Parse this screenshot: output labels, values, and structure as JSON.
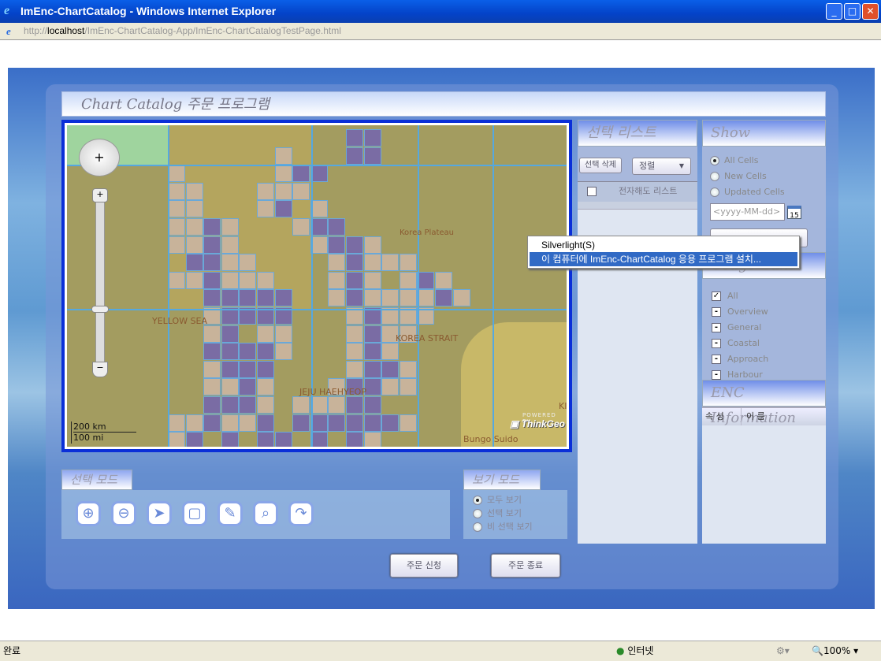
{
  "window": {
    "title": "ImEnc-ChartCatalog - Windows Internet Explorer",
    "url_prefix": "http://",
    "url_host": "localhost",
    "url_path": "/ImEnc-ChartCatalog-App/ImEnc-ChartCatalogTestPage.html"
  },
  "app": {
    "title": "Chart Catalog 주문 프로그램"
  },
  "map": {
    "labels": {
      "yellow_sea": "YELLOW SEA",
      "korea_strait": "KOREA STRAIT",
      "korea_plateau": "Korea Plateau",
      "jeju": "JEJU HAEHYEOP",
      "bungo": "Bungo Suido",
      "ki": "KI"
    },
    "scale_km": "200 km",
    "scale_mi": "100 mi",
    "powered_by": "POWERED BY",
    "brand": "ThinkGeo"
  },
  "select_list": {
    "title": "선택 리스트",
    "delete_button": "선택 삭제",
    "sort_dropdown": "정렬",
    "column": "전자해도 리스트"
  },
  "show": {
    "title": "Show",
    "options": [
      {
        "label": "All Cells",
        "selected": true
      },
      {
        "label": "New Cells",
        "selected": false
      },
      {
        "label": "Updated Cells",
        "selected": false
      }
    ],
    "date_placeholder": "<yyyy-MM-dd>",
    "calendar_day": "15"
  },
  "usage_band": {
    "title": "Usage Band",
    "items": [
      {
        "label": "All",
        "checked": true
      },
      {
        "label": "Overview"
      },
      {
        "label": "General"
      },
      {
        "label": "Coastal"
      },
      {
        "label": "Approach"
      },
      {
        "label": "Harbour"
      }
    ]
  },
  "enc_info": {
    "title": "ENC Information",
    "columns": [
      "속 성",
      "이 름"
    ]
  },
  "select_mode": {
    "title": "선택 모드",
    "tools": [
      "zoom-in",
      "zoom-out",
      "pointer",
      "rectangle-select",
      "pin",
      "globe-search",
      "redo"
    ]
  },
  "view_mode": {
    "title": "보기 모드",
    "options": [
      {
        "label": "모두 보기",
        "selected": true
      },
      {
        "label": "선택 보기",
        "selected": false
      },
      {
        "label": "비 선택 보기",
        "selected": false
      }
    ]
  },
  "actions": {
    "order": "주문 신청",
    "exit": "주문 종료"
  },
  "context_menu": {
    "item1": "Silverlight(S)",
    "item2": "이 컴퓨터에 ImEnc-ChartCatalog 응용 프로그램 설치..."
  },
  "statusbar": {
    "status": "완료",
    "zone": "인터넷",
    "zoom": "100%"
  },
  "colors": {
    "highlight": "#316ac5",
    "map_frame": "#0a2fd8",
    "selected_cell": "#7a6ca4",
    "cell": "#c8b39a"
  }
}
